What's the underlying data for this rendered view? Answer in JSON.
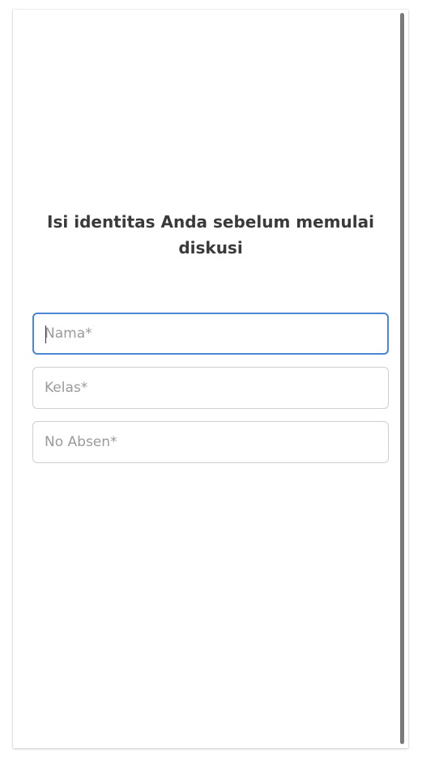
{
  "form": {
    "heading": "Isi identitas Anda sebelum memulai diskusi",
    "fields": [
      {
        "placeholder": "Nama*",
        "value": ""
      },
      {
        "placeholder": "Kelas*",
        "value": ""
      },
      {
        "placeholder": "No Absen*",
        "value": ""
      }
    ]
  },
  "colors": {
    "focus_border": "#4a86d4",
    "border": "#cfcfcf",
    "heading_text": "#3a3a3a",
    "placeholder_text": "#9a9a9a",
    "scrollbar": "#7a7a7a"
  }
}
